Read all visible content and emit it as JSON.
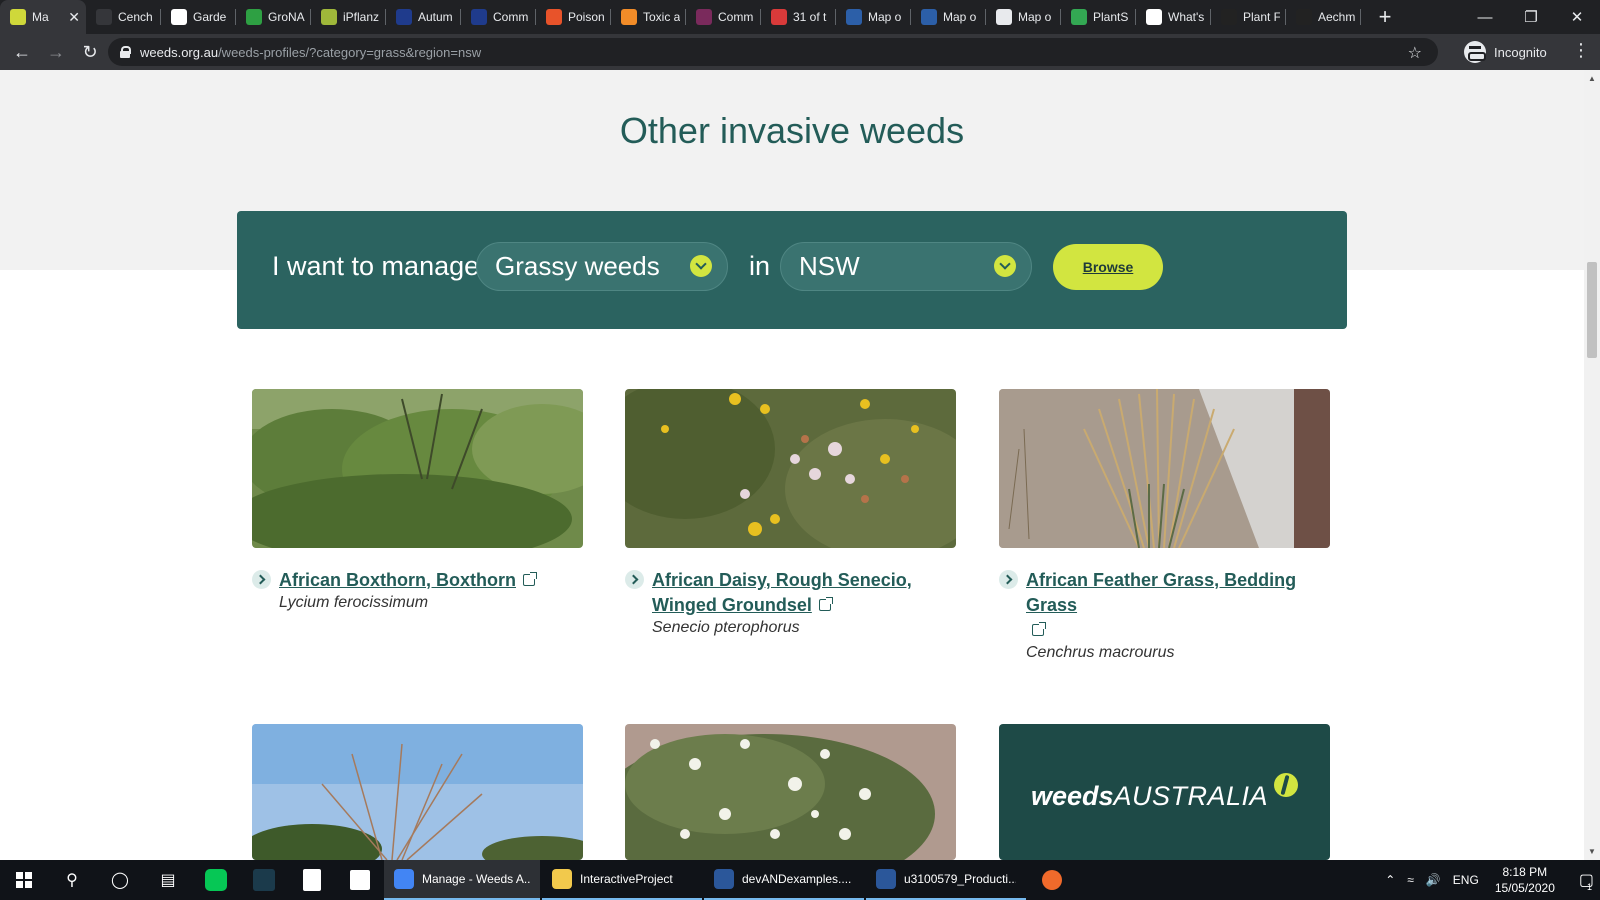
{
  "browser": {
    "tabs": [
      {
        "title": "Ma",
        "fav_color": "#cfd83a",
        "active": true
      },
      {
        "title": "Cench",
        "fav_color": "#35363a"
      },
      {
        "title": "Garde",
        "fav_color": "#ffffff"
      },
      {
        "title": "GroNA",
        "fav_color": "#2ea043"
      },
      {
        "title": "iPflanz",
        "fav_color": "#9fb83a"
      },
      {
        "title": "Autum",
        "fav_color": "#1f3b8c"
      },
      {
        "title": "Comm",
        "fav_color": "#1f3b8c"
      },
      {
        "title": "Poison",
        "fav_color": "#e8532a"
      },
      {
        "title": "Toxic a",
        "fav_color": "#f28c28"
      },
      {
        "title": "Comm",
        "fav_color": "#7a2a5c"
      },
      {
        "title": "31 of t",
        "fav_color": "#d93a3a"
      },
      {
        "title": "Map o",
        "fav_color": "#2c5fa8"
      },
      {
        "title": "Map o",
        "fav_color": "#2c5fa8"
      },
      {
        "title": "Map o",
        "fav_color": "#e8eaed"
      },
      {
        "title": "PlantS",
        "fav_color": "#33a853"
      },
      {
        "title": "What's",
        "fav_color": "#ffffff"
      },
      {
        "title": "Plant F",
        "fav_color": "#222222"
      },
      {
        "title": "Aechm",
        "fav_color": "#222222"
      }
    ],
    "new_tab": "+",
    "url_domain": "weeds.org.au",
    "url_path": "/weeds-profiles/?category=grass&region=nsw",
    "profile_label": "Incognito",
    "window_controls": {
      "minimize": "—",
      "restore": "❐",
      "close": "✕"
    }
  },
  "page": {
    "heading": "Other invasive weeds",
    "filter": {
      "prefix": "I want to manage",
      "category_value": "Grassy weeds",
      "connector": "in",
      "region_value": "NSW",
      "browse_label": "Browse"
    },
    "cards": [
      {
        "name": "African Boxthorn, Boxthorn",
        "scientific": "Lycium ferocissimum"
      },
      {
        "name_line1": "African Daisy, Rough Senecio,",
        "name_line2": "Winged Groundsel",
        "scientific": "Senecio pterophorus"
      },
      {
        "name": "African Feather Grass, Bedding Grass",
        "scientific": "Cenchrus macrourus"
      }
    ],
    "logo": {
      "bold": "weeds",
      "rest": "AUSTRALIA"
    }
  },
  "taskbar": {
    "apps": [
      {
        "label": "Manage - Weeds A...",
        "icon_color": "#4285f4",
        "state": "open"
      },
      {
        "label": "InteractiveProject",
        "icon_color": "#f2c94c",
        "state": "running"
      },
      {
        "label": "devANDexamples....",
        "icon_color": "#2b579a",
        "state": "running"
      },
      {
        "label": "u3100579_Producti...",
        "icon_color": "#2b579a",
        "state": "running"
      }
    ],
    "language": "ENG",
    "time": "8:18 PM",
    "date": "15/05/2020",
    "notification_count": "1"
  }
}
